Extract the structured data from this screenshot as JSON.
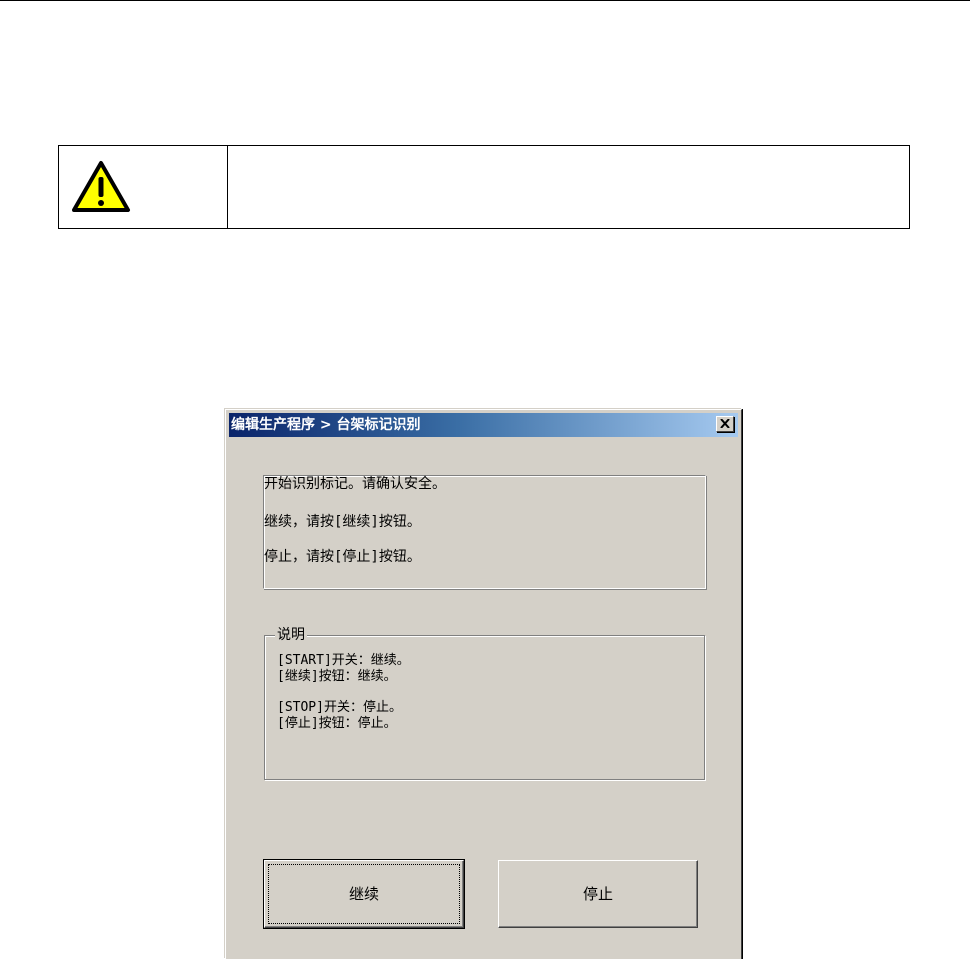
{
  "dialog": {
    "title": "编辑生产程序 > 台架标记识别",
    "close_label": "×"
  },
  "message": {
    "lines": [
      "开始识别标记。请确认安全。",
      "继续，请按[继续]按钮。",
      "停止，请按[停止]按钮。"
    ]
  },
  "notes": {
    "legend": "说明",
    "lines": [
      "[START]开关：继续。",
      "[继续]按钮：继续。",
      "[STOP]开关：停止。",
      "[停止]按钮：停止。"
    ]
  },
  "buttons": {
    "continue_label": "继续",
    "stop_label": "停止"
  },
  "colors": {
    "dialog_face": "#d4d0c8",
    "title_start": "#0a246a",
    "title_end": "#a6caf0",
    "warning_fill": "#ffff00"
  },
  "icons": {
    "warning": "warning-triangle-icon",
    "close": "close-icon"
  }
}
